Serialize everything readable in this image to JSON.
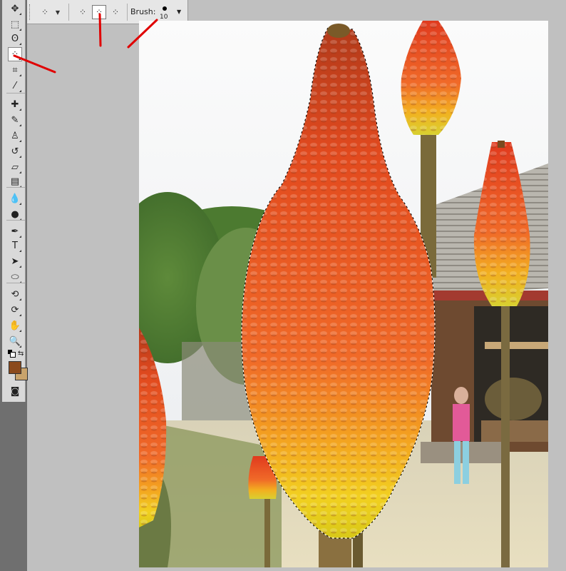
{
  "options_bar": {
    "brush_label": "Brush:",
    "brush_size": "10"
  },
  "tools": [
    {
      "name": "move-tool-icon",
      "glyph": "✥"
    },
    {
      "name": "marquee-tool-icon",
      "glyph": "⬚"
    },
    {
      "name": "lasso-tool-icon",
      "glyph": "ʘ"
    },
    {
      "name": "quick-selection-tool-icon",
      "glyph": "⁘",
      "active": true
    },
    {
      "name": "crop-tool-icon",
      "glyph": "⌗"
    },
    {
      "name": "eyedropper-tool-icon",
      "glyph": "⁄"
    },
    {
      "name": "healing-brush-tool-icon",
      "glyph": "✚"
    },
    {
      "name": "brush-tool-icon",
      "glyph": "✎"
    },
    {
      "name": "clone-stamp-tool-icon",
      "glyph": "♙"
    },
    {
      "name": "history-brush-tool-icon",
      "glyph": "↺"
    },
    {
      "name": "eraser-tool-icon",
      "glyph": "▱"
    },
    {
      "name": "gradient-tool-icon",
      "glyph": "▤"
    },
    {
      "name": "blur-tool-icon",
      "glyph": "💧"
    },
    {
      "name": "dodge-tool-icon",
      "glyph": "●"
    },
    {
      "name": "pen-tool-icon",
      "glyph": "✒"
    },
    {
      "name": "type-tool-icon",
      "glyph": "T"
    },
    {
      "name": "path-selection-tool-icon",
      "glyph": "➤"
    },
    {
      "name": "shape-tool-icon",
      "glyph": "⬭"
    },
    {
      "name": "3d-rotate-tool-icon",
      "glyph": "⟲"
    },
    {
      "name": "3d-orbit-tool-icon",
      "glyph": "⟳"
    },
    {
      "name": "hand-tool-icon",
      "glyph": "✋"
    },
    {
      "name": "zoom-tool-icon",
      "glyph": "🔍"
    }
  ],
  "colors": {
    "foreground": "#8b4a1c",
    "background": "#c9a36b",
    "annotation": "#e00000"
  }
}
